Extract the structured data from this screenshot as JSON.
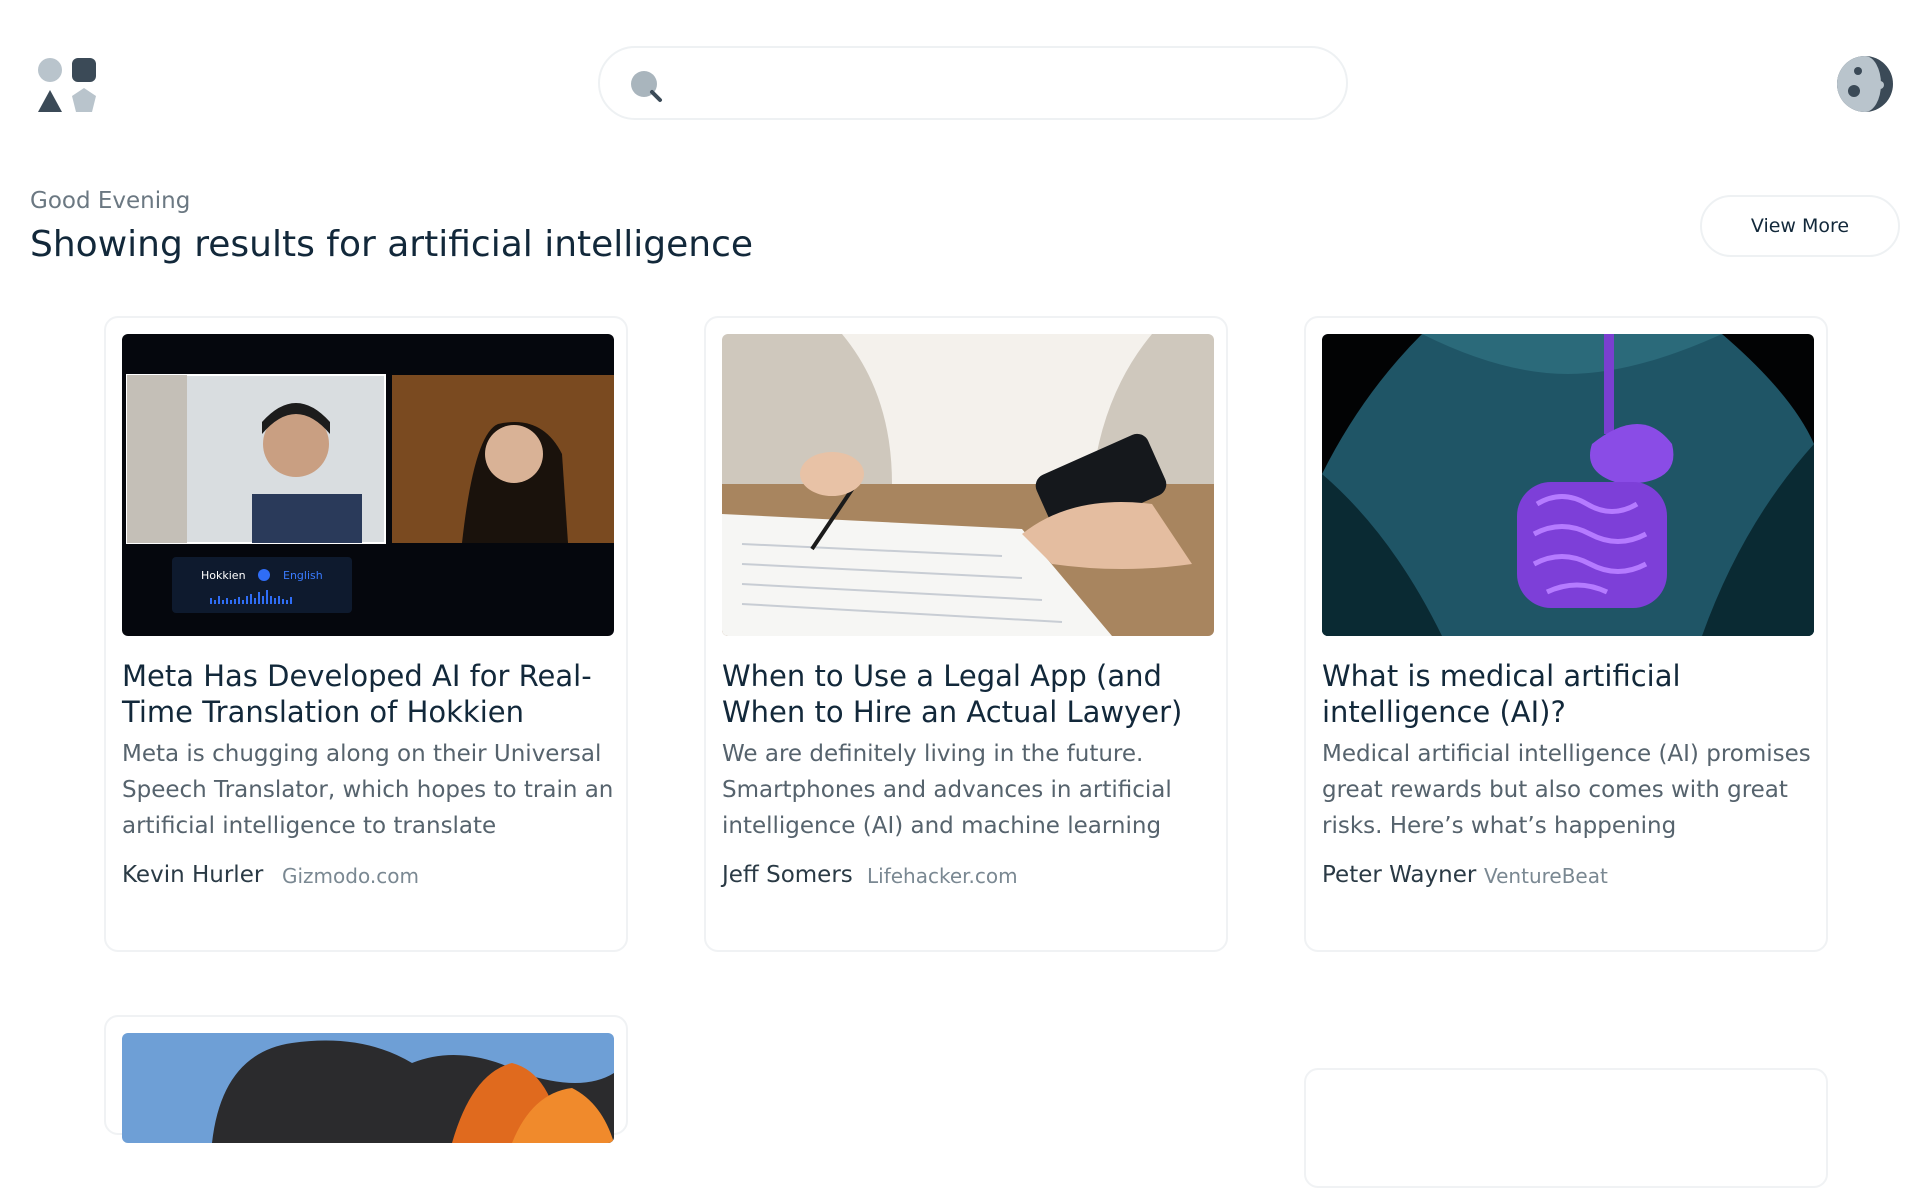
{
  "header": {
    "logo_icon": "shapes-logo-icon",
    "search": {
      "icon": "search-icon",
      "value": "",
      "placeholder": ""
    },
    "avatar_icon": "user-avatar-icon"
  },
  "main": {
    "greeting": "Good Evening",
    "results_title": "Showing results for artificial intelligence",
    "view_more_label": "View More",
    "cards": [
      {
        "image": "video-call-translation-image",
        "image_caption_from": "Hokkien",
        "image_caption_to": "English",
        "title": "Meta Has Developed AI for Real-Time Translation of Hokkien",
        "description": "Meta is chugging along on their Universal Speech Translator, which hopes to train an artificial intelligence to translate",
        "author": "Kevin Hurler",
        "source": "Gizmodo.com"
      },
      {
        "image": "phone-and-document-image",
        "title": "When to Use a Legal App (and When to Hire an Actual Lawyer)",
        "description": "We are definitely living in the future. Smartphones and advances in artificial intelligence (AI) and machine learning",
        "author": "Jeff Somers",
        "source": "Lifehacker.com"
      },
      {
        "image": "digestive-system-image",
        "title": "What is medical artificial intelligence (AI)?",
        "description": "Medical artificial intelligence (AI) promises great rewards but also comes with great risks. Here’s what’s happening",
        "author": "Peter Wayner",
        "source": "VentureBeat"
      },
      {
        "image": "fire-smoke-image"
      }
    ]
  },
  "colors": {
    "primary_text": "#12283a",
    "muted_text": "#6b7882",
    "border": "#eef1f3",
    "logo": "#3b4a57"
  }
}
